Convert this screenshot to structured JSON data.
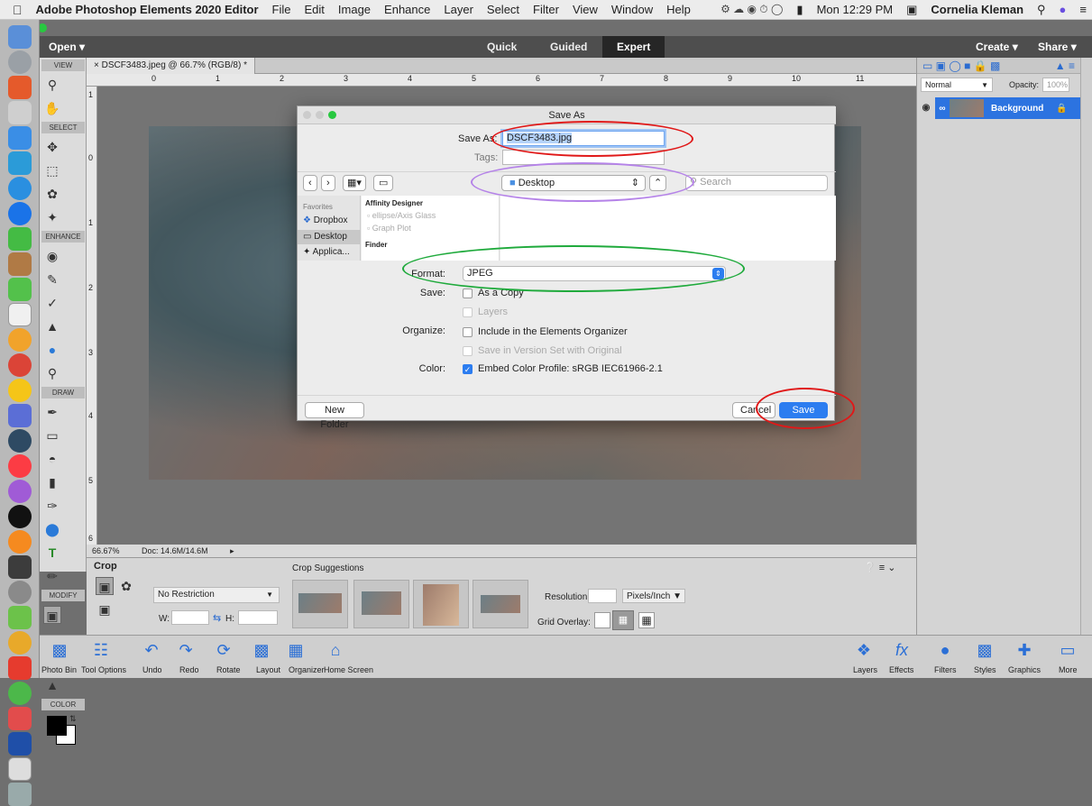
{
  "menubar": {
    "app_name": "Adobe Photoshop Elements 2020 Editor",
    "items": [
      "File",
      "Edit",
      "Image",
      "Enhance",
      "Layer",
      "Select",
      "Filter",
      "View",
      "Window",
      "Help"
    ],
    "clock": "Mon 12:29 PM",
    "user": "Cornelia Kleman"
  },
  "appbar": {
    "open_label": "Open",
    "modes": [
      "Quick",
      "Guided",
      "Expert"
    ],
    "active_mode": "Expert",
    "create_label": "Create",
    "share_label": "Share"
  },
  "toolbox": {
    "sections": [
      "VIEW",
      "SELECT",
      "ENHANCE",
      "DRAW",
      "MODIFY",
      "COLOR"
    ]
  },
  "document": {
    "tab_title": "DSCF3483.jpeg @ 66.7% (RGB/8) *",
    "zoom": "66.67%",
    "doc_info": "Doc: 14.6M/14.6M",
    "ruler_h": [
      "0",
      "1",
      "2",
      "3",
      "4",
      "5",
      "6",
      "7",
      "8",
      "9",
      "10",
      "11"
    ],
    "ruler_v": [
      "1",
      "0",
      "1",
      "2",
      "3",
      "4",
      "5",
      "6"
    ]
  },
  "layers": {
    "blend_mode": "Normal",
    "opacity_label": "Opacity:",
    "opacity_value": "100%",
    "layer_name": "Background"
  },
  "dialog": {
    "title": "Save As",
    "save_as_label": "Save As:",
    "filename": "DSCF3483.jpg",
    "tags_label": "Tags:",
    "location": "Desktop",
    "search_placeholder": "Search",
    "sidebar": {
      "favorites_heading": "Favorites",
      "items": [
        "Dropbox",
        "Desktop",
        "Applica..."
      ]
    },
    "column1": {
      "heading": "Affinity Designer",
      "items": [
        "ellipse/Axis Glass",
        "Graph Plot"
      ],
      "heading2": "Finder"
    },
    "format_label": "Format:",
    "format_value": "JPEG",
    "save_label": "Save:",
    "save_options": [
      "As a Copy",
      "Layers"
    ],
    "organize_label": "Organize:",
    "organize_options": [
      "Include in the Elements Organizer",
      "Save in Version Set with Original"
    ],
    "color_label": "Color:",
    "color_option": "Embed Color Profile:  sRGB IEC61966-2.1",
    "new_folder": "New Folder",
    "cancel": "Cancel",
    "save": "Save"
  },
  "tool_options": {
    "tool_name": "Crop",
    "restriction": "No Restriction",
    "w_label": "W:",
    "h_label": "H:",
    "suggestions_label": "Crop Suggestions",
    "resolution_label": "Resolution:",
    "resolution_unit": "Pixels/Inch",
    "grid_overlay_label": "Grid Overlay:"
  },
  "bottombar": {
    "left": [
      "Photo Bin",
      "Tool Options",
      "Undo",
      "Redo",
      "Rotate",
      "Layout",
      "Organizer",
      "Home Screen"
    ],
    "right": [
      "Layers",
      "Effects",
      "Filters",
      "Styles",
      "Graphics",
      "More"
    ]
  },
  "annotation_colors": {
    "filename_ring": "#e01818",
    "location_ring": "#b583e8",
    "format_ring": "#1faa3c",
    "save_ring": "#e01818"
  }
}
